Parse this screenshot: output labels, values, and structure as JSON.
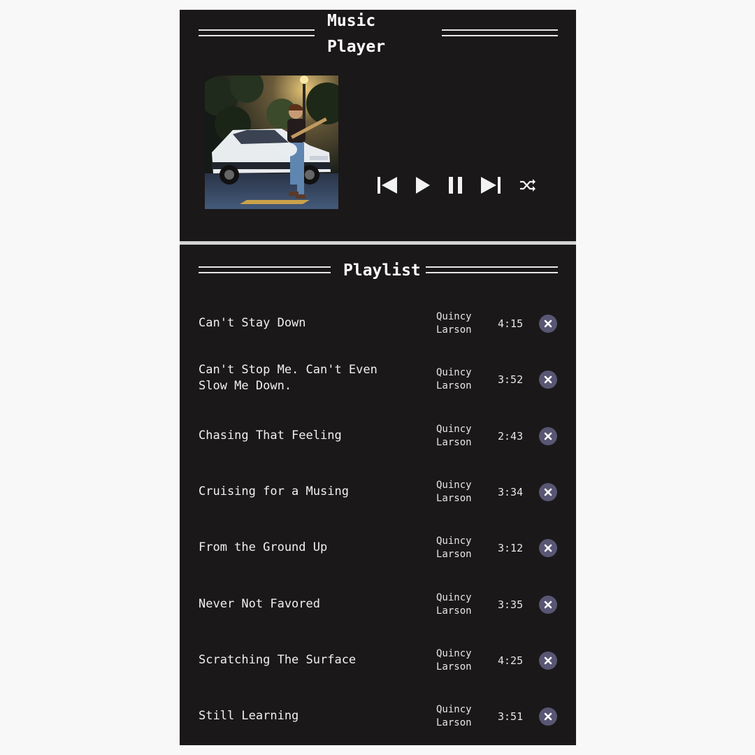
{
  "app": {
    "title_line1": "Music",
    "title_line2": "Player"
  },
  "player": {
    "cover_alt": "album cover art",
    "controls": {
      "previous": "previous-icon",
      "play": "play-icon",
      "pause": "pause-icon",
      "next": "next-icon",
      "shuffle": "shuffle-icon"
    }
  },
  "playlist": {
    "heading": "Playlist",
    "songs": [
      {
        "title_line1": "Can't Stay Down",
        "title_line2": "",
        "artist_line1": "Quincy",
        "artist_line2": "Larson",
        "duration": "4:15"
      },
      {
        "title_line1": "Can't Stop Me. Can't Even",
        "title_line2": "Slow Me Down.",
        "artist_line1": "Quincy",
        "artist_line2": "Larson",
        "duration": "3:52"
      },
      {
        "title_line1": "Chasing That Feeling",
        "title_line2": "",
        "artist_line1": "Quincy",
        "artist_line2": "Larson",
        "duration": "2:43"
      },
      {
        "title_line1": "Cruising for a Musing",
        "title_line2": "",
        "artist_line1": "Quincy",
        "artist_line2": "Larson",
        "duration": "3:34"
      },
      {
        "title_line1": "From the Ground Up",
        "title_line2": "",
        "artist_line1": "Quincy",
        "artist_line2": "Larson",
        "duration": "3:12"
      },
      {
        "title_line1": "Never Not Favored",
        "title_line2": "",
        "artist_line1": "Quincy",
        "artist_line2": "Larson",
        "duration": "3:35"
      },
      {
        "title_line1": "Scratching The Surface",
        "title_line2": "",
        "artist_line1": "Quincy",
        "artist_line2": "Larson",
        "duration": "4:25"
      },
      {
        "title_line1": "Still Learning",
        "title_line2": "",
        "artist_line1": "Quincy",
        "artist_line2": "Larson",
        "duration": "3:51"
      }
    ]
  },
  "colors": {
    "panel_bg": "#1b1819",
    "page_bg": "#f8f8f8",
    "text": "#ffffff",
    "delete_button": "#585674",
    "divider": "#d4d4d4"
  }
}
